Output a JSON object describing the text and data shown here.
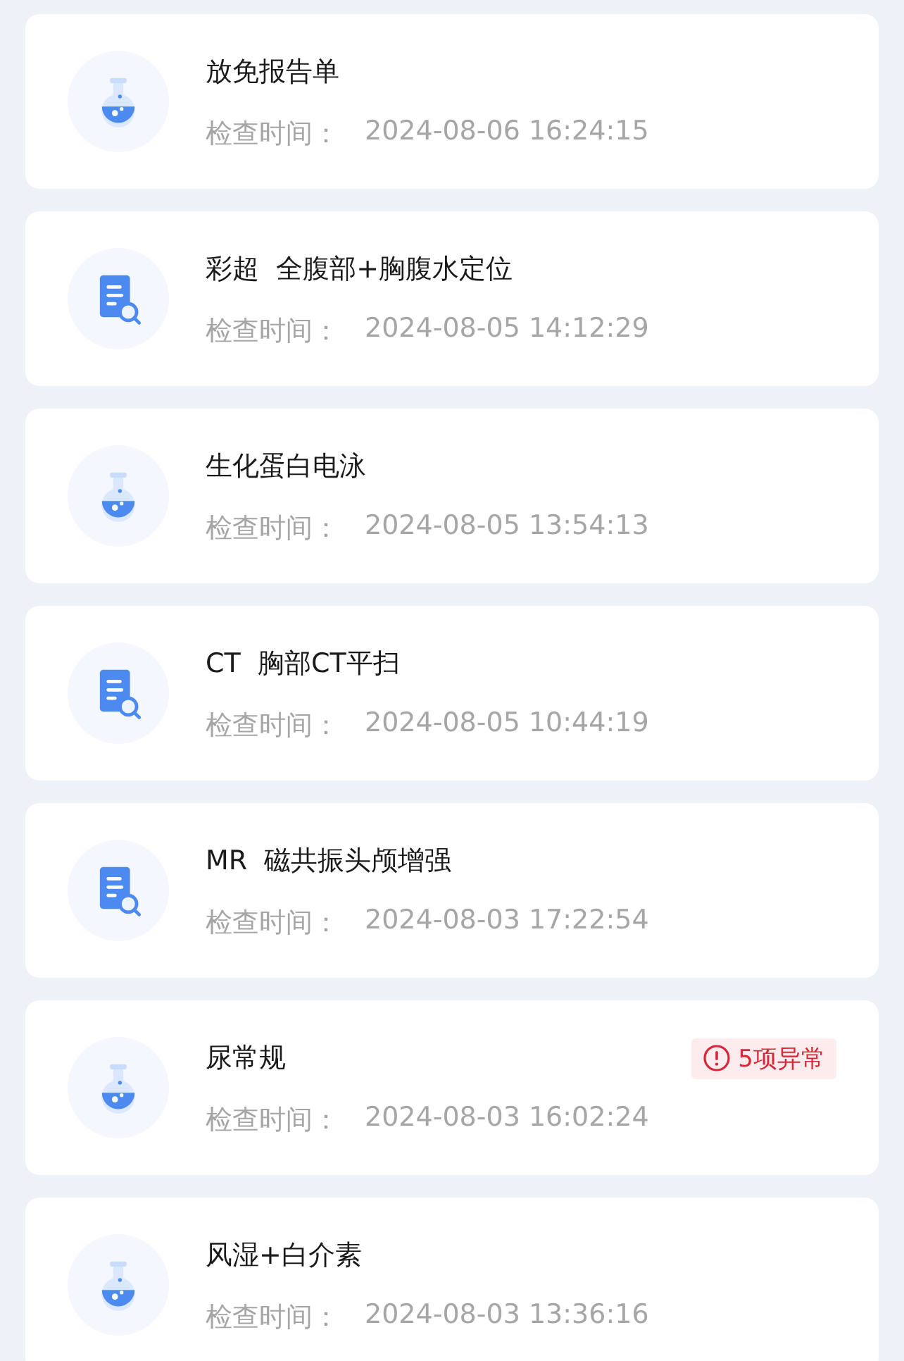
{
  "reports": [
    {
      "kind": "lab",
      "title": "放免报告单",
      "time_label": "检查时间：",
      "time": "2024-08-06 16:24:15"
    },
    {
      "kind": "exam",
      "title": "彩超  全腹部+胸腹水定位",
      "time_label": "检查时间：",
      "time": "2024-08-05 14:12:29"
    },
    {
      "kind": "lab",
      "title": "生化蛋白电泳",
      "time_label": "检查时间：",
      "time": "2024-08-05 13:54:13"
    },
    {
      "kind": "exam",
      "title": "CT  胸部CT平扫",
      "time_label": "检查时间：",
      "time": "2024-08-05 10:44:19"
    },
    {
      "kind": "exam",
      "title": "MR  磁共振头颅增强",
      "time_label": "检查时间：",
      "time": "2024-08-03 17:22:54"
    },
    {
      "kind": "lab",
      "title": "尿常规",
      "time_label": "检查时间：",
      "time": "2024-08-03 16:02:24",
      "abnormal": "5项异常"
    },
    {
      "kind": "lab",
      "title": "风湿+白介素",
      "time_label": "检查时间：",
      "time": "2024-08-03 13:36:16"
    }
  ]
}
